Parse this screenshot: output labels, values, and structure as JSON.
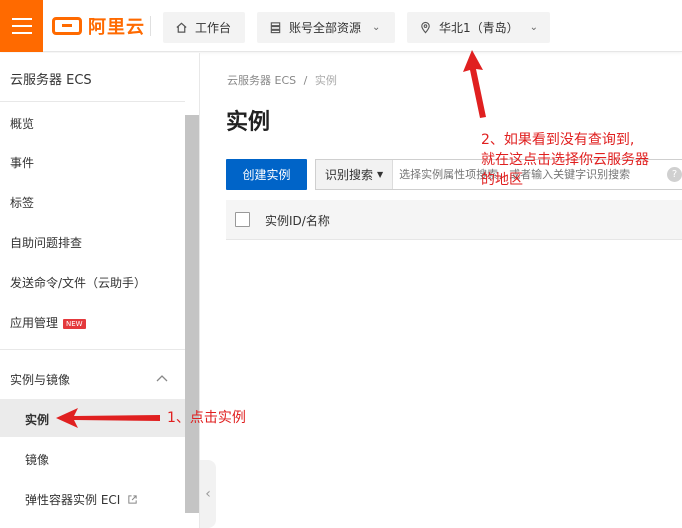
{
  "topbar": {
    "logo_text": "阿里云",
    "workbench_label": "工作台",
    "resources_label": "账号全部资源",
    "region_label": "华北1（青岛）"
  },
  "sidebar": {
    "title": "云服务器 ECS",
    "items": [
      {
        "label": "概览"
      },
      {
        "label": "事件"
      },
      {
        "label": "标签"
      },
      {
        "label": "自助问题排查"
      },
      {
        "label": "发送命令/文件（云助手）"
      },
      {
        "label": "应用管理",
        "badge": "NEW"
      }
    ],
    "group_label": "实例与镜像",
    "group_items": [
      {
        "label": "实例"
      },
      {
        "label": "镜像"
      },
      {
        "label": "弹性容器实例 ECI"
      }
    ]
  },
  "main": {
    "breadcrumb_root": "云服务器 ECS",
    "breadcrumb_sep": "/",
    "breadcrumb_current": "实例",
    "page_title": "实例",
    "create_button": "创建实例",
    "search_mode": "识别搜索",
    "search_placeholder": "选择实例属性项搜索，或者输入关键字识别搜索",
    "table_col_id": "实例ID/名称"
  },
  "annotations": {
    "step1": "1、点击实例",
    "step2_line1": "2、如果看到没有查询到,",
    "step2_line2": "就在这点击选择你云服务器",
    "step2_line3": "的地区"
  },
  "colors": {
    "brand": "#ff6a00",
    "primary": "#0064c8",
    "annotation": "#e02020"
  }
}
